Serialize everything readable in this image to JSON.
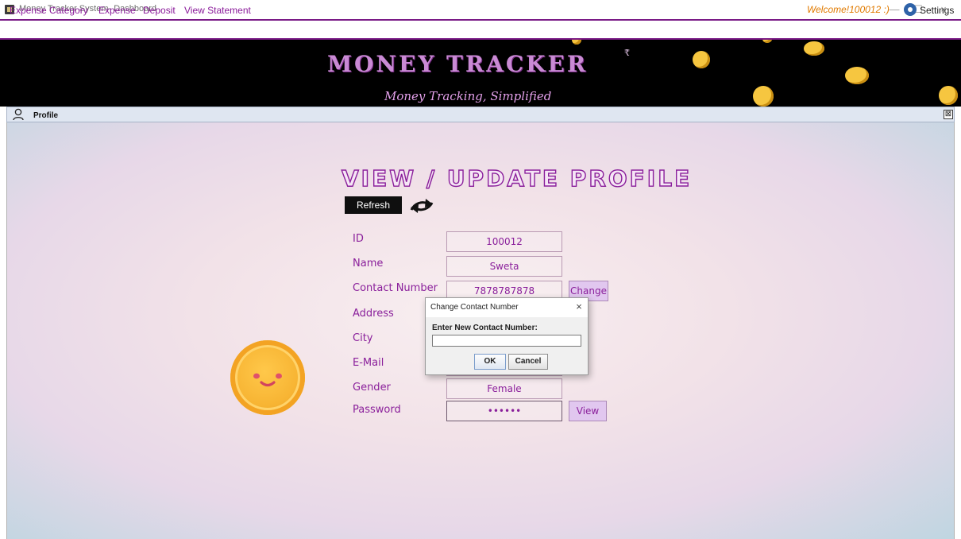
{
  "window": {
    "title": "Money Tracker System- Dashboard",
    "minimize_glyph": "—",
    "maximize_glyph": "☐",
    "close_glyph": "×"
  },
  "menu": {
    "items": [
      "Expense Category",
      "Expense",
      "Deposit",
      "View Statement"
    ],
    "welcome": "Welcome!100012 :)",
    "settings_label": "Settings",
    "settings_icon": "gear-icon"
  },
  "banner": {
    "title": "MONEY TRACKER",
    "title_sup": "₹",
    "subtitle": "Money Tracking, Simplified"
  },
  "frame": {
    "title": "Profile",
    "icon": "user-icon",
    "close_glyph": "⊠"
  },
  "profile": {
    "heading": "VIEW / UPDATE PROFILE",
    "refresh_label": "Refresh",
    "refresh_icon": "refresh-arrows-icon",
    "fields": {
      "id": {
        "label": "ID",
        "value": "100012"
      },
      "name": {
        "label": "Name",
        "value": "Sweta"
      },
      "contact": {
        "label": "Contact Number",
        "value": "7878787878"
      },
      "address": {
        "label": "Address",
        "value": ""
      },
      "city": {
        "label": "City",
        "value": ""
      },
      "email": {
        "label": "E-Mail",
        "value": ""
      },
      "gender": {
        "label": "Gender",
        "value": "Female"
      },
      "password": {
        "label": "Password",
        "value": "••••••"
      }
    },
    "change_label": "Change",
    "view_label": "View"
  },
  "dialog": {
    "title": "Change Contact Number",
    "close_glyph": "×",
    "prompt": "Enter New Contact Number:",
    "input_value": "",
    "ok_label": "OK",
    "cancel_label": "Cancel"
  },
  "colors": {
    "accent": "#8a1f9b",
    "banner_title": "#c98ad4",
    "coin": "#f6c640"
  }
}
